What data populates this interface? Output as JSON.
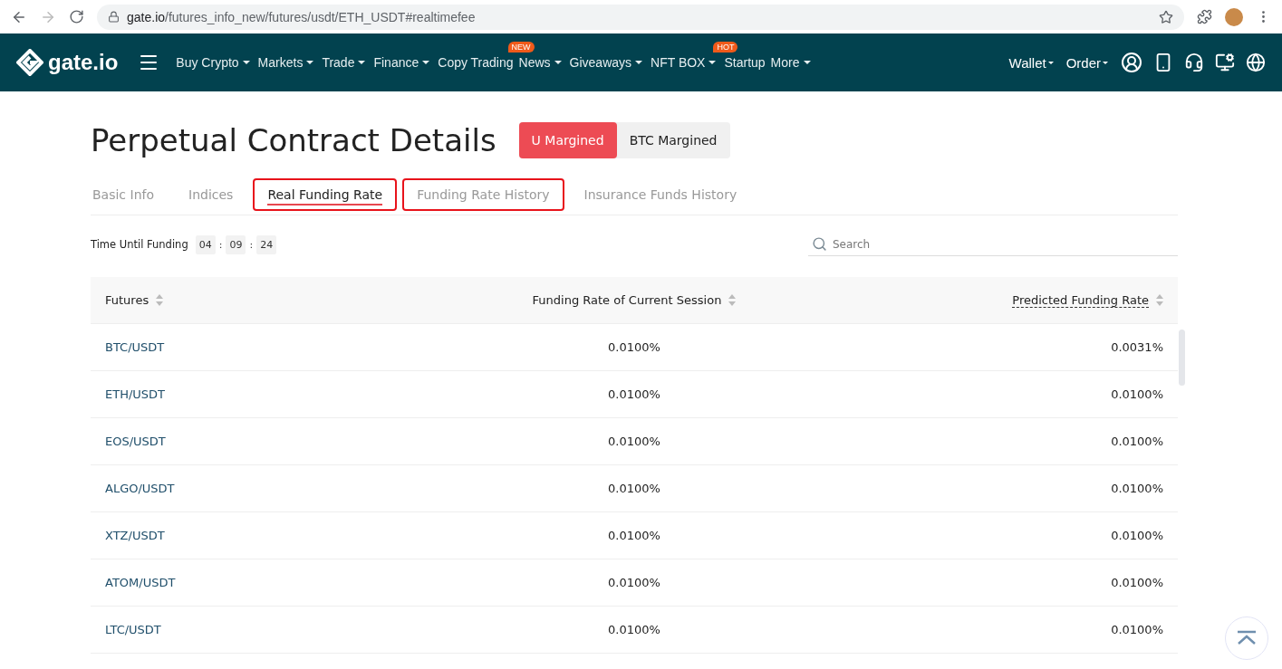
{
  "browser": {
    "url_host": "gate.io",
    "url_path": "/futures_info_new/futures/usdt/ETH_USDT#realtimefee"
  },
  "nav": {
    "logo": "gate.io",
    "items": [
      {
        "label": "Buy Crypto",
        "dropdown": true
      },
      {
        "label": "Markets",
        "dropdown": true
      },
      {
        "label": "Trade",
        "dropdown": true
      },
      {
        "label": "Finance",
        "dropdown": true
      },
      {
        "label": "Copy Trading",
        "dropdown": false
      },
      {
        "label": "News",
        "dropdown": true,
        "badge": "NEW"
      },
      {
        "label": "Giveaways",
        "dropdown": true
      },
      {
        "label": "NFT BOX",
        "dropdown": true
      },
      {
        "label": "Startup",
        "dropdown": false,
        "badge": "HOT"
      },
      {
        "label": "More",
        "dropdown": true
      }
    ],
    "right": [
      {
        "label": "Wallet"
      },
      {
        "label": "Order"
      }
    ]
  },
  "page": {
    "title": "Perpetual Contract Details",
    "margin_toggle": [
      {
        "label": "U Margined",
        "selected": true
      },
      {
        "label": "BTC Margined",
        "selected": false
      }
    ]
  },
  "tabs": [
    {
      "label": "Basic Info",
      "selected": false,
      "highlighted": false
    },
    {
      "label": "Indices",
      "selected": false,
      "highlighted": false
    },
    {
      "label": "Real Funding Rate",
      "selected": true,
      "highlighted": true
    },
    {
      "label": "Funding Rate History",
      "selected": false,
      "highlighted": true
    },
    {
      "label": "Insurance Funds History",
      "selected": false,
      "highlighted": false
    }
  ],
  "countdown": {
    "label": "Time Until Funding",
    "parts": [
      "04",
      "09",
      "24"
    ],
    "separator": ":"
  },
  "search": {
    "placeholder": "Search"
  },
  "table": {
    "columns": [
      "Futures",
      "Funding Rate of Current Session",
      "Predicted Funding Rate"
    ],
    "rows": [
      [
        "BTC/USDT",
        "0.0100%",
        "0.0031%"
      ],
      [
        "ETH/USDT",
        "0.0100%",
        "0.0100%"
      ],
      [
        "EOS/USDT",
        "0.0100%",
        "0.0100%"
      ],
      [
        "ALGO/USDT",
        "0.0100%",
        "0.0100%"
      ],
      [
        "XTZ/USDT",
        "0.0100%",
        "0.0100%"
      ],
      [
        "ATOM/USDT",
        "0.0100%",
        "0.0100%"
      ],
      [
        "LTC/USDT",
        "0.0100%",
        "0.0100%"
      ]
    ]
  }
}
